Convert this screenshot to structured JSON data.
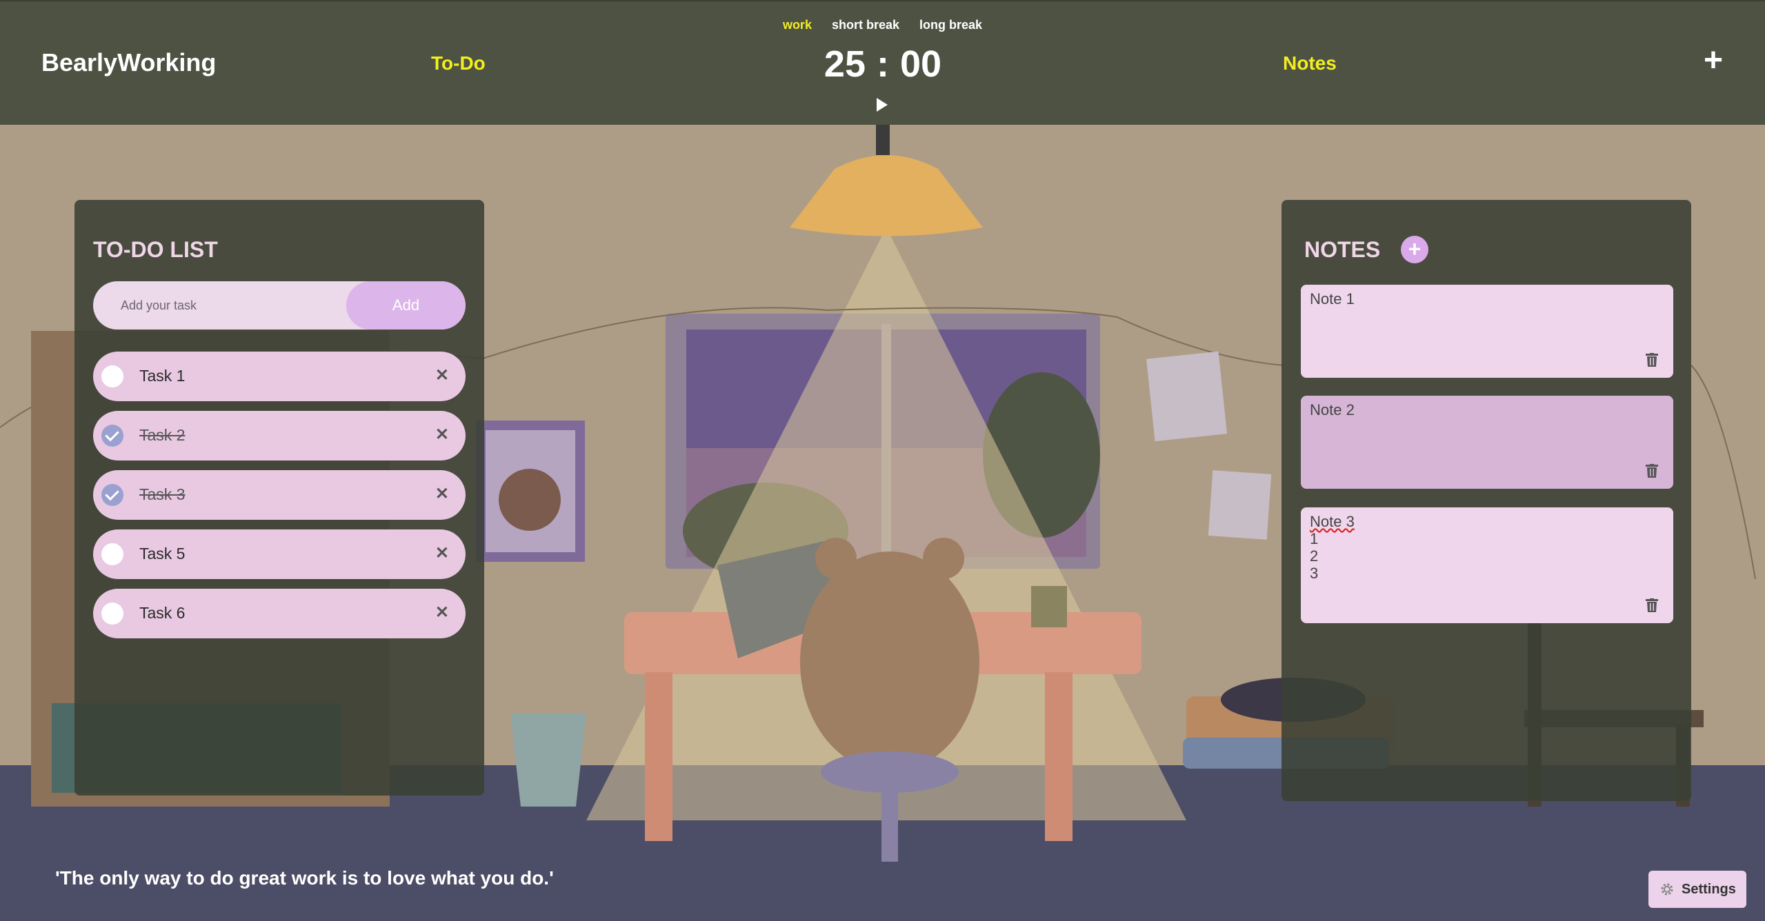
{
  "header": {
    "brand": "BearlyWorking",
    "nav_todo": "To-Do",
    "nav_notes": "Notes",
    "add_label": "+",
    "modes": [
      "work",
      "short break",
      "long break"
    ],
    "active_mode": "work",
    "timer": {
      "minutes": "25",
      "separator": ":",
      "seconds": "00"
    },
    "play_icon": "play-icon"
  },
  "todo": {
    "title": "TO-DO LIST",
    "input_placeholder": "Add your task",
    "add_label": "Add",
    "tasks": [
      {
        "label": "Task 1",
        "done": false
      },
      {
        "label": "Task 2",
        "done": true
      },
      {
        "label": "Task 3",
        "done": true
      },
      {
        "label": "Task 5",
        "done": false
      },
      {
        "label": "Task 6",
        "done": false
      }
    ],
    "delete_icon": "close-icon"
  },
  "notes": {
    "title": "NOTES",
    "add_label": "+",
    "items": [
      {
        "text": "Note 1"
      },
      {
        "text": "Note 2"
      },
      {
        "text": "Note 3",
        "lines": [
          "1",
          "2",
          "3"
        ]
      }
    ],
    "delete_icon": "trash-icon"
  },
  "footer": {
    "quote": "'The only way to do great work is to love what you do.'",
    "settings_label": "Settings",
    "settings_icon": "gear-icon"
  },
  "colors": {
    "header_bg": "#4d5242",
    "accent_yellow": "#f2ee1f",
    "panel_bg": "#3a4034",
    "task_bg": "#e9c9e2",
    "add_button": "#dcb5ea",
    "note_bg": "#efd6ec"
  }
}
